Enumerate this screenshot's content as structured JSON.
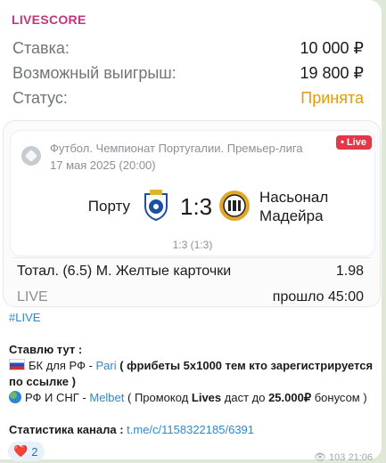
{
  "header": {
    "title": "LIVESCORE"
  },
  "summary": {
    "stake_label": "Ставка:",
    "stake_value": "10 000 ₽",
    "win_label": "Возможный выигрыш:",
    "win_value": "19 800 ₽",
    "status_label": "Статус:",
    "status_value": "Принята"
  },
  "match": {
    "league": "Футбол. Чемпионат Португалии. Премьер-лига",
    "date": "17 мая 2025 (20:00)",
    "live_badge": "• Live",
    "home_team": "Порту",
    "away_team_line1": "Насьонал",
    "away_team_line2": "Мадейра",
    "score": "1:3",
    "halftime": "1:3 (1:3)",
    "bet": "Тотал. (6.5) М. Желтые карточки",
    "odd": "1.98",
    "live_label": "LIVE",
    "time_status": "прошло 45:00"
  },
  "message": {
    "hashtag": "#LIVE",
    "place_here": "Ставлю тут :",
    "line_rf_prefix": "БК для РФ - ",
    "line_rf_link": "Pari",
    "line_rf_suffix": " ( фрибеты 5х1000 тем кто зарегистрируется по ссылке )",
    "line_cis_prefix": "РФ И СНГ - ",
    "line_cis_link": "Melbet",
    "line_cis_mid": " ( Промокод ",
    "line_cis_code": "Lives",
    "line_cis_mid2": " даст до ",
    "line_cis_amount": "25.000₽",
    "line_cis_suffix": " бонусом )",
    "stats_label": "Статистика канала : ",
    "stats_link": "t.me/c/1158322185/6391"
  },
  "reaction": {
    "emoji": "❤️",
    "count": "2"
  },
  "meta": {
    "views": "103",
    "time": "21:06"
  },
  "colors": {
    "accent": "#c2357c",
    "status": "#e39a12",
    "live": "#e5374a",
    "link": "#2e88c8"
  }
}
